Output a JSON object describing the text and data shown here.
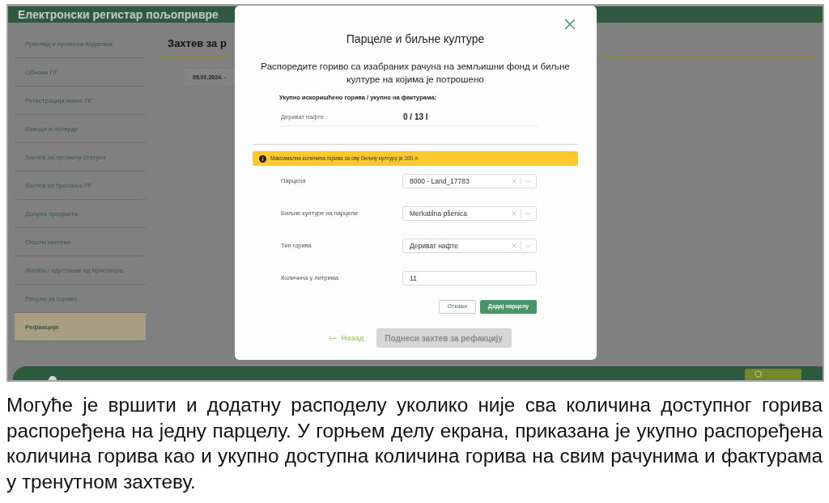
{
  "screenshot": {
    "app_header": {
      "title": "Електронски регистар пољопривре"
    },
    "sidebar": {
      "items": [
        {
          "label": "Преглед и промена података",
          "selected": false
        },
        {
          "label": "Обнова ПГ",
          "selected": false
        },
        {
          "label": "Регистрација новог ПГ",
          "selected": false
        },
        {
          "label": "Изводи и потврде",
          "selected": false
        },
        {
          "label": "Захтев за промену статуса",
          "selected": false
        },
        {
          "label": "Захтев за брисање ПГ",
          "selected": false
        },
        {
          "label": "Допуна предмета",
          "selected": false
        },
        {
          "label": "Општи захтеви",
          "selected": false
        },
        {
          "label": "Жалба / одустанак од приговора",
          "selected": false
        },
        {
          "label": "Рачуни за гориво",
          "selected": false
        },
        {
          "label": "Рефакција",
          "selected": true
        }
      ]
    },
    "main": {
      "heading": "Захтев за р",
      "date": "05.01.2024. -"
    },
    "modal": {
      "title": "Парцеле и биљне културе",
      "subtitle": "Распоредите гориво са изабраних рачуна на земљишни фонд и биљне културе на којима је потрошено",
      "totals": {
        "heading": "Укупно искоришћено горива / укупно на фактурама:",
        "rows": [
          {
            "label": "Дериват нафте",
            "value": "0 / 13 l"
          }
        ]
      },
      "warning": "Максимална количина горива за ову биљну културу је 100 л",
      "fields": [
        {
          "kind": "select",
          "label": "Парцела",
          "value": "8000 - Land_17783"
        },
        {
          "kind": "select",
          "label": "Биљне културе на парцели",
          "value": "Merkatilna pšenica"
        },
        {
          "kind": "select",
          "label": "Тип горива",
          "value": "Дериват нафте"
        },
        {
          "kind": "input",
          "label": "Количина у литрима",
          "value": "11"
        }
      ],
      "form_buttons": [
        {
          "kind": "secondary",
          "label": "Откажи"
        },
        {
          "kind": "primary",
          "label": "Додај парцелу"
        }
      ],
      "back_link": {
        "label": "Назад"
      },
      "submit_button": {
        "label": "Поднеси захтев за рефакцију",
        "disabled": true
      }
    }
  },
  "caption": "Могуће је вршити и додатну расподелу уколико није сва количина доступног горива распоређена на једну парцелу. У горњем делу екрана, приказана је укупно распоређена количина горива као и укупно доступна количина горива на свим рачунима и фактурама у тренутном захтеву."
}
